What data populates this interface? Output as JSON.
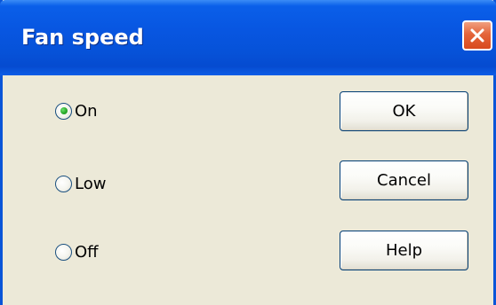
{
  "window": {
    "title": "Fan speed"
  },
  "radio_group": {
    "options": [
      {
        "label": "On",
        "selected": true
      },
      {
        "label": "Low",
        "selected": false
      },
      {
        "label": "Off",
        "selected": false
      }
    ]
  },
  "buttons": {
    "ok": "OK",
    "cancel": "Cancel",
    "help": "Help"
  },
  "colors": {
    "titlebar": "#0652d8",
    "close_button": "#e4643a",
    "client_background": "#ece9d8",
    "radio_selected_dot": "#2eae2e"
  },
  "icons": {
    "close": "close-icon"
  }
}
